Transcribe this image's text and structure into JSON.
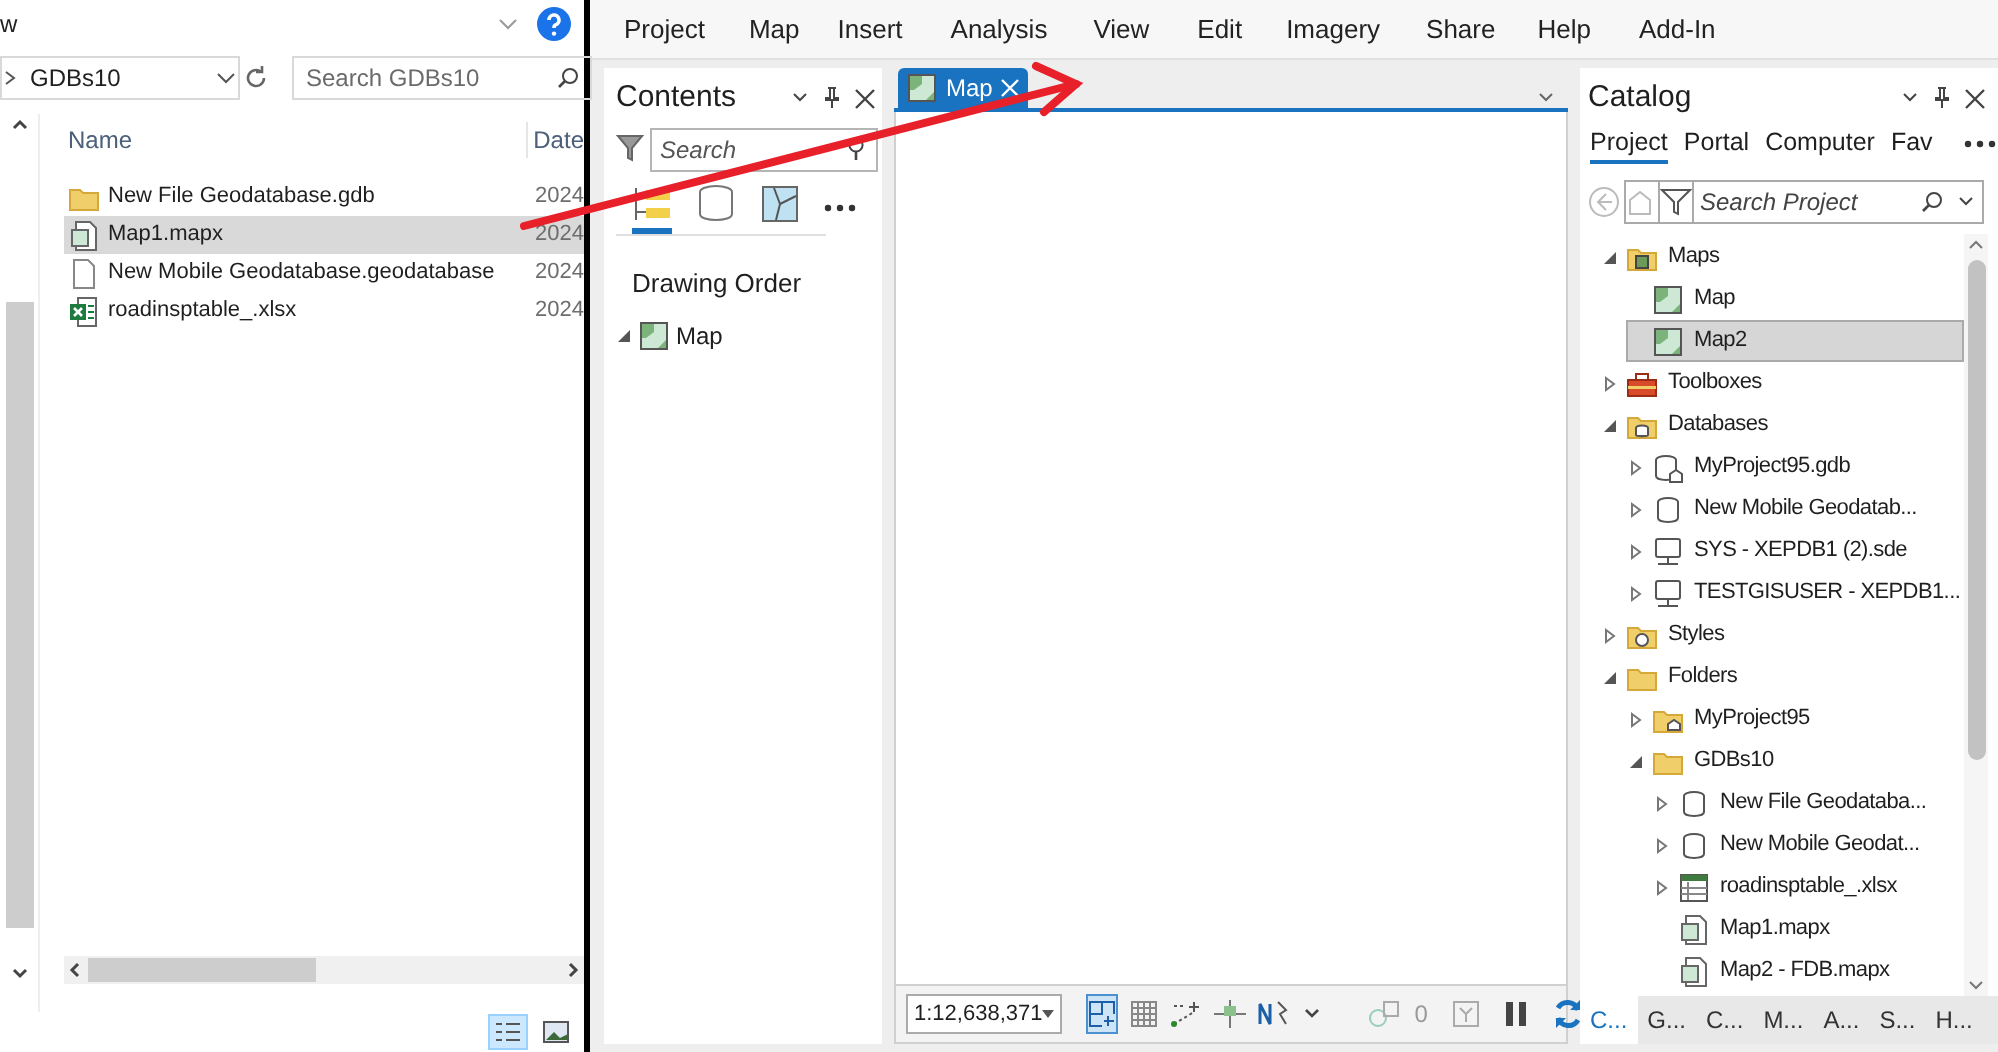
{
  "explorer": {
    "menu_partial": "w",
    "breadcrumb": "GDBs10",
    "search": {
      "placeholder": "Search GDBs10"
    },
    "columns": [
      "Name",
      "Date"
    ],
    "files": [
      {
        "name": "New File Geodatabase.gdb",
        "kind": "folder",
        "date": "2024",
        "selected": false
      },
      {
        "name": "Map1.mapx",
        "kind": "mapx",
        "date": "2024",
        "selected": true
      },
      {
        "name": "New Mobile Geodatabase.geodatabase",
        "kind": "file",
        "date": "2024",
        "selected": false
      },
      {
        "name": "roadinsptable_.xlsx",
        "kind": "excel",
        "date": "2024",
        "selected": false
      }
    ],
    "view_buttons": [
      {
        "kind": "details",
        "selected": true
      },
      {
        "kind": "tiles",
        "selected": false
      }
    ]
  },
  "ribbon_tabs": [
    "Project",
    "Map",
    "Insert",
    "Analysis",
    "View",
    "Edit",
    "Imagery",
    "Share",
    "Help",
    "Add-In"
  ],
  "contents": {
    "title": "Contents",
    "search": {
      "placeholder": "Search"
    },
    "view_tabs": [
      {
        "kind": "drawing-order",
        "selected": true
      },
      {
        "kind": "source",
        "selected": false
      },
      {
        "kind": "selection",
        "selected": false
      }
    ],
    "heading": "Drawing Order",
    "layers": [
      {
        "label": "Map",
        "expanded": true
      }
    ]
  },
  "map_view": {
    "tabs": [
      {
        "label": "Map",
        "selected": true
      }
    ]
  },
  "status_bar": {
    "scale": "1:12,638,371",
    "selection_count": "0"
  },
  "catalog": {
    "title": "Catalog",
    "tabs": [
      {
        "label": "Project",
        "selected": true
      },
      {
        "label": "Portal",
        "selected": false
      },
      {
        "label": "Computer",
        "selected": false
      },
      {
        "label": "Fav",
        "selected": false
      }
    ],
    "search": {
      "placeholder": "Search Project"
    },
    "tree": [
      {
        "label": "Maps",
        "kind": "maps-folder",
        "expanded": true,
        "selected": false,
        "children": [
          {
            "label": "Map",
            "kind": "map",
            "selected": false
          },
          {
            "label": "Map2",
            "kind": "map",
            "selected": true
          }
        ]
      },
      {
        "label": "Toolboxes",
        "kind": "toolbox",
        "expanded": false,
        "selected": false
      },
      {
        "label": "Databases",
        "kind": "db-folder",
        "expanded": true,
        "selected": false,
        "children": [
          {
            "label": "MyProject95.gdb",
            "kind": "gdb-home",
            "expanded": false,
            "selected": false
          },
          {
            "label": "New Mobile Geodatab...",
            "kind": "database",
            "expanded": false,
            "selected": false
          },
          {
            "label": "SYS - XEPDB1 (2).sde",
            "kind": "server",
            "expanded": false,
            "selected": false
          },
          {
            "label": "TESTGISUSER - XEPDB1...",
            "kind": "server",
            "expanded": false,
            "selected": false
          }
        ]
      },
      {
        "label": "Styles",
        "kind": "style-folder",
        "expanded": false,
        "selected": false
      },
      {
        "label": "Folders",
        "kind": "folder",
        "expanded": true,
        "selected": false,
        "children": [
          {
            "label": "MyProject95",
            "kind": "folder-home",
            "expanded": false,
            "selected": false
          },
          {
            "label": "GDBs10",
            "kind": "folder",
            "expanded": true,
            "selected": false,
            "children": [
              {
                "label": "New File Geodataba...",
                "kind": "database",
                "expanded": false,
                "selected": false
              },
              {
                "label": "New Mobile Geodat...",
                "kind": "database",
                "expanded": false,
                "selected": false
              },
              {
                "label": "roadinsptable_.xlsx",
                "kind": "table",
                "expanded": false,
                "selected": false
              },
              {
                "label": "Map1.mapx",
                "kind": "mapx",
                "selected": false
              },
              {
                "label": "Map2 - FDB.mapx",
                "kind": "mapx",
                "selected": false
              }
            ]
          }
        ]
      }
    ],
    "bottom_tabs": [
      {
        "label": "C...",
        "selected": true
      },
      {
        "label": "G...",
        "selected": false
      },
      {
        "label": "C...",
        "selected": false
      },
      {
        "label": "M...",
        "selected": false
      },
      {
        "label": "A...",
        "selected": false
      },
      {
        "label": "S...",
        "selected": false
      },
      {
        "label": "H...",
        "selected": false
      }
    ]
  }
}
